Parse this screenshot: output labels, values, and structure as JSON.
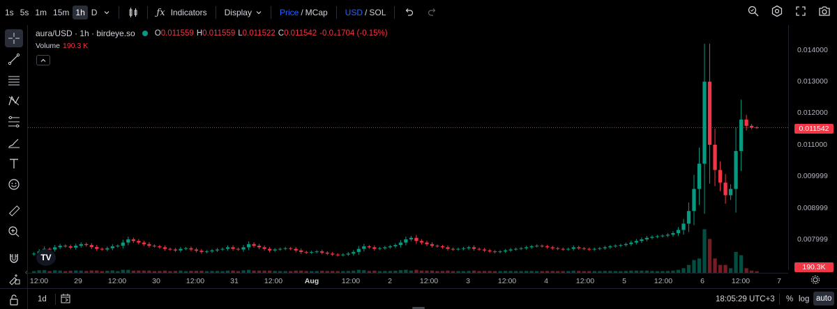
{
  "toolbar": {
    "timeframes": [
      "1s",
      "5s",
      "1m",
      "15m",
      "1h",
      "D"
    ],
    "active_timeframe": "1h",
    "indicators_label": "Indicators",
    "display_label": "Display",
    "price_label": "Price",
    "mcap_label": "MCap",
    "usd_label": "USD",
    "sol_label": "SOL",
    "separator": "/"
  },
  "legend": {
    "symbol": "aura/USD · 1h · birdeye.so",
    "o_key": "O",
    "o_val": "0.011559",
    "h_key": "H",
    "h_val": "0.011559",
    "l_key": "L",
    "l_val": "0.011522",
    "c_key": "C",
    "c_val": "0.011542",
    "change": "-0.0₄1704 (-0.15%)",
    "volume_label": "Volume",
    "volume_value": "190.3 K"
  },
  "price_axis": {
    "ticks": [
      "0.014000",
      "0.013000",
      "0.012000",
      "0.011000",
      "0.009999",
      "0.008999",
      "0.007999"
    ],
    "last_price": "0.011542",
    "volume_label": "190.3K"
  },
  "time_axis": {
    "ticks": [
      "12:00",
      "29",
      "12:00",
      "30",
      "12:00",
      "31",
      "12:00",
      "Aug",
      "12:00",
      "2",
      "12:00",
      "3",
      "12:00",
      "4",
      "12:00",
      "5",
      "12:00",
      "6",
      "12:00",
      "7"
    ]
  },
  "bottom": {
    "range": "1d",
    "clock": "18:05:29 UTC+3",
    "percent": "%",
    "log": "log",
    "auto": "auto"
  },
  "colors": {
    "up": "#089981",
    "down": "#f23645",
    "accent": "#2962ff"
  },
  "chart_data": {
    "type": "candlestick",
    "title": "aura/USD · 1h · birdeye.so",
    "ylim": [
      0.0072,
      0.0145
    ],
    "note_on_x": "hourly candles from Jul 28 to Aug 6",
    "close_series": [
      0.00755,
      0.00762,
      0.0077,
      0.00768,
      0.00775,
      0.0078,
      0.00778,
      0.00774,
      0.0078,
      0.00785,
      0.00782,
      0.00776,
      0.0077,
      0.00768,
      0.00772,
      0.00778,
      0.0078,
      0.0079,
      0.008,
      0.00795,
      0.0079,
      0.00785,
      0.0078,
      0.00778,
      0.00775,
      0.0077,
      0.00768,
      0.00765,
      0.0077,
      0.00772,
      0.00768,
      0.00764,
      0.0076,
      0.00762,
      0.00765,
      0.00768,
      0.0077,
      0.00775,
      0.0077,
      0.00768,
      0.00775,
      0.00785,
      0.0078,
      0.00775,
      0.0077,
      0.00765,
      0.00768,
      0.0077,
      0.00772,
      0.0077,
      0.00765,
      0.0076,
      0.00758,
      0.0076,
      0.00762,
      0.00758,
      0.00755,
      0.00752,
      0.0075,
      0.00752,
      0.00755,
      0.0076,
      0.0077,
      0.00778,
      0.00775,
      0.0077,
      0.00772,
      0.00775,
      0.00778,
      0.00782,
      0.0079,
      0.008,
      0.00805,
      0.00795,
      0.0079,
      0.00785,
      0.0078,
      0.00778,
      0.00775,
      0.0077,
      0.00768,
      0.0077,
      0.00772,
      0.00775,
      0.0077,
      0.00768,
      0.00765,
      0.00762,
      0.0076,
      0.00762,
      0.00765,
      0.00768,
      0.0077,
      0.00772,
      0.00775,
      0.00778,
      0.0078,
      0.00778,
      0.00775,
      0.00772,
      0.0077,
      0.00768,
      0.0077,
      0.00775,
      0.00772,
      0.0077,
      0.00768,
      0.0077,
      0.00772,
      0.00775,
      0.00778,
      0.0078,
      0.00782,
      0.00785,
      0.0079,
      0.00795,
      0.008,
      0.00805,
      0.00808,
      0.0081,
      0.00812,
      0.00815,
      0.0082,
      0.0083,
      0.0085,
      0.0089,
      0.0096,
      0.0104,
      0.013,
      0.011,
      0.0102,
      0.0098,
      0.0094,
      0.0096,
      0.0108,
      0.0118,
      0.0116,
      0.01155,
      0.011542
    ]
  }
}
